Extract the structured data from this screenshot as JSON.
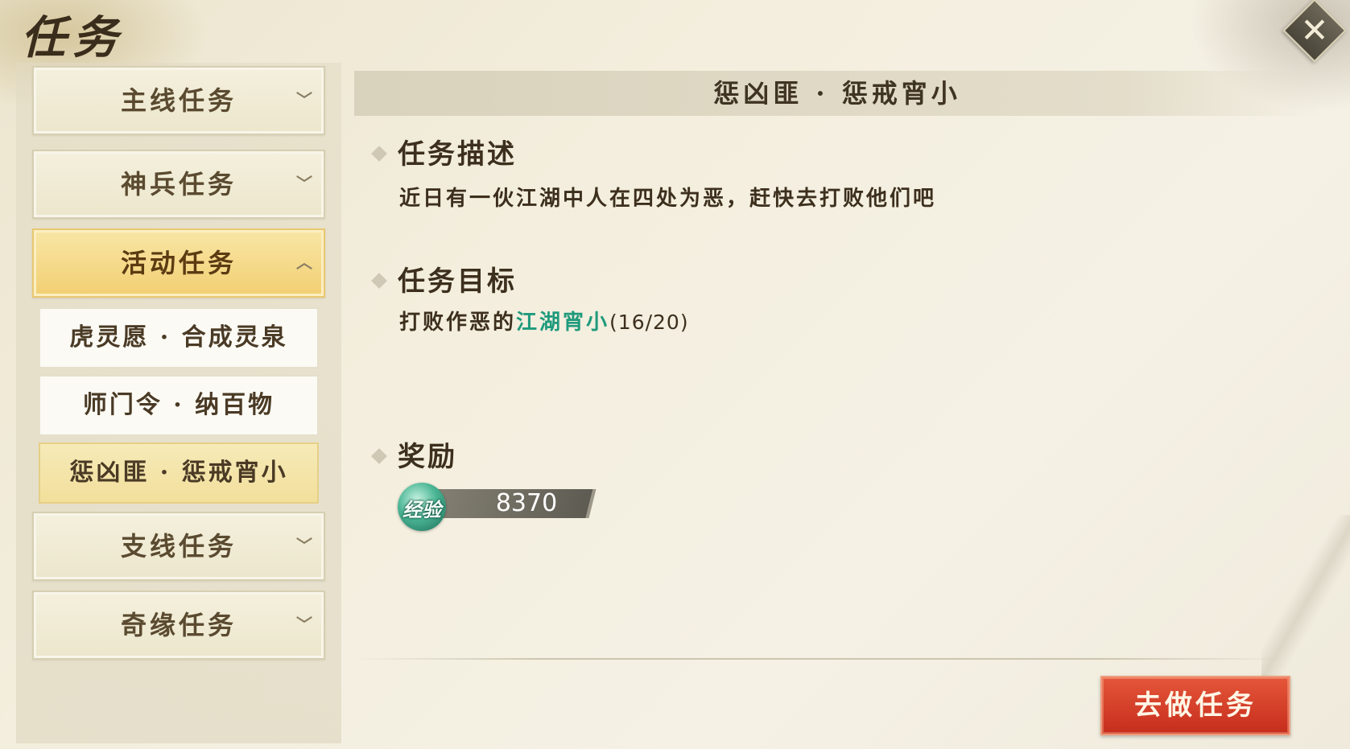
{
  "page": {
    "title": "任务"
  },
  "close": {
    "icon": "close-icon",
    "symbol": "✕"
  },
  "sidebar": {
    "categories": [
      {
        "label": "主线任务",
        "icon": "chevron-down-icon",
        "symbol": "﹀",
        "active": false
      },
      {
        "label": "神兵任务",
        "icon": "chevron-down-icon",
        "symbol": "﹀",
        "active": false
      },
      {
        "label": "活动任务",
        "icon": "chevron-up-icon",
        "symbol": "︿",
        "active": true
      },
      {
        "label": "支线任务",
        "icon": "chevron-down-icon",
        "symbol": "﹀",
        "active": false
      },
      {
        "label": "奇缘任务",
        "icon": "chevron-down-icon",
        "symbol": "﹀",
        "active": false
      }
    ],
    "subitems": [
      {
        "label": "虎灵愿 · 合成灵泉",
        "selected": false
      },
      {
        "label": "师门令 · 纳百物",
        "selected": false
      },
      {
        "label": "惩凶匪 · 惩戒宵小",
        "selected": true
      }
    ]
  },
  "detail": {
    "header": "惩凶匪 · 惩戒宵小",
    "description": {
      "title": "任务描述",
      "text": "近日有一伙江湖中人在四处为恶，赶快去打败他们吧"
    },
    "objective": {
      "title": "任务目标",
      "prefix": "打败作恶的",
      "target": "江湖宵小",
      "progress": "(16/20)"
    },
    "reward": {
      "title": "奖励",
      "type_label": "经验",
      "value": "8370"
    }
  },
  "actions": {
    "go_label": "去做任务"
  },
  "colors": {
    "accent_active": "#f2cf72",
    "target_text": "#1f9a7c",
    "go_button": "#d5402a"
  }
}
